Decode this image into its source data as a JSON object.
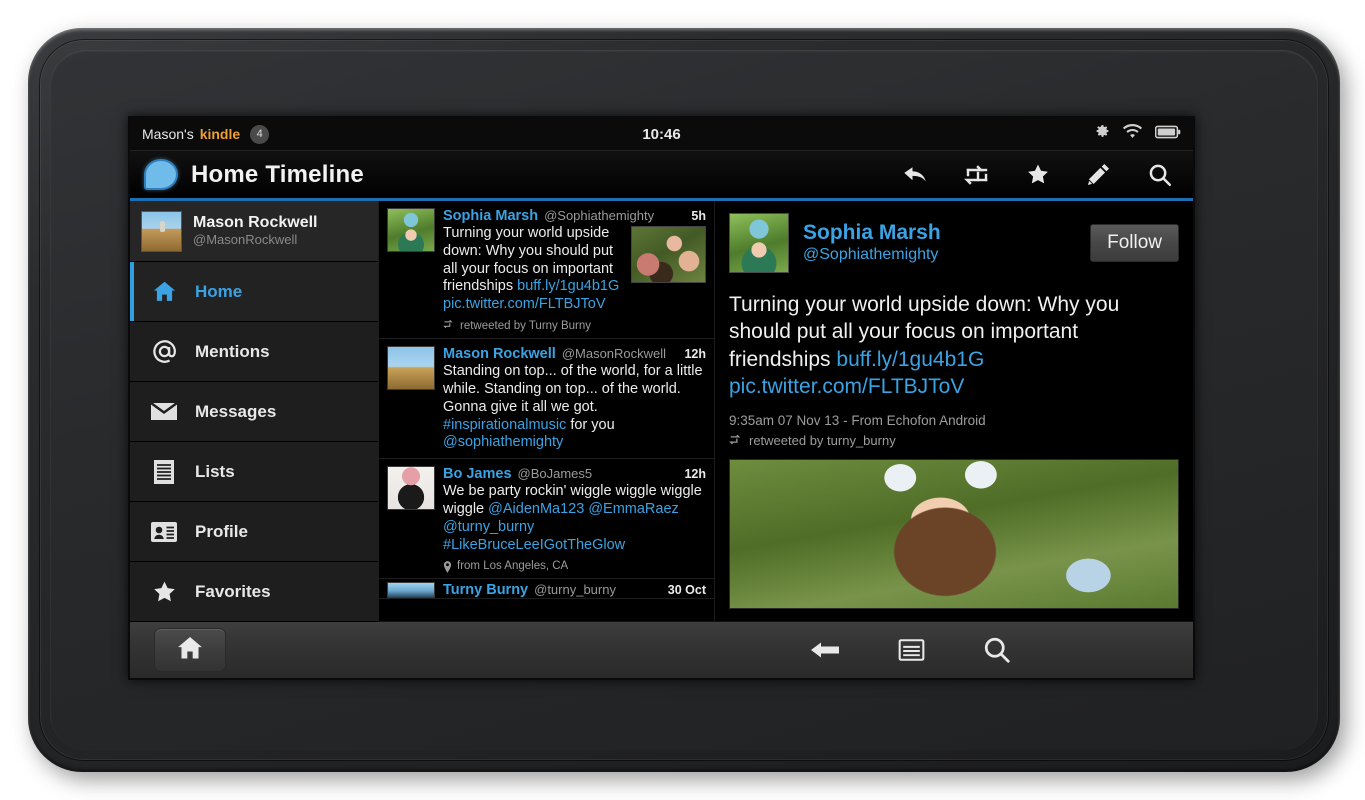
{
  "device": {
    "frame_color": "#2a2c2e"
  },
  "status_bar": {
    "owner_label": "Mason's",
    "brand_label": "kindle",
    "notification_count": "4",
    "clock": "10:46",
    "icons": [
      "gear-icon",
      "wifi-icon",
      "battery-icon"
    ]
  },
  "app_header": {
    "title": "Home Timeline",
    "accent_color": "#1b6fb5",
    "actions": [
      "reply-icon",
      "retweet-icon",
      "star-icon",
      "compose-pencil-icon",
      "search-icon"
    ]
  },
  "sidebar": {
    "account": {
      "name": "Mason Rockwell",
      "handle": "@MasonRockwell"
    },
    "items": [
      {
        "label": "Home",
        "icon": "home-icon",
        "active": true
      },
      {
        "label": "Mentions",
        "icon": "at-sign-icon",
        "active": false
      },
      {
        "label": "Messages",
        "icon": "envelope-icon",
        "active": false
      },
      {
        "label": "Lists",
        "icon": "list-icon",
        "active": false
      },
      {
        "label": "Profile",
        "icon": "contact-card-icon",
        "active": false
      },
      {
        "label": "Favorites",
        "icon": "star-icon",
        "active": false
      }
    ]
  },
  "tweet_list": [
    {
      "name": "Sophia Marsh",
      "handle": "@Sophiathemighty",
      "time": "5h",
      "text_parts": [
        {
          "t": "Turning your world upside down: Why you should put all your focus on important friendships ",
          "link": false
        },
        {
          "t": "buff.ly/1gu4b1G",
          "link": true
        },
        {
          "t": " ",
          "link": false
        },
        {
          "t": "pic.twitter.com/FLTBJToV",
          "link": true
        }
      ],
      "meta_icon": "retweet-icon",
      "meta": "retweeted by Turny Burny",
      "has_image": true
    },
    {
      "name": "Mason Rockwell",
      "handle": "@MasonRockwell",
      "time": "12h",
      "text_parts": [
        {
          "t": "Standing on top... of the world, for a little while. Standing on top... of the world. Gonna give it all we got. ",
          "link": false
        },
        {
          "t": "#inspirationalmusic",
          "link": true
        },
        {
          "t": " for you ",
          "link": false
        },
        {
          "t": "@sophiathemighty",
          "link": true
        }
      ],
      "meta_icon": "",
      "meta": "",
      "has_image": false
    },
    {
      "name": "Bo James",
      "handle": "@BoJames5",
      "time": "12h",
      "text_parts": [
        {
          "t": "We be party rockin' wiggle wiggle wiggle wiggle ",
          "link": false
        },
        {
          "t": "@AidenMa123",
          "link": true
        },
        {
          "t": " ",
          "link": false
        },
        {
          "t": "@EmmaRaez",
          "link": true
        },
        {
          "t": " ",
          "link": false
        },
        {
          "t": "@turny_burny",
          "link": true
        },
        {
          "t": " ",
          "link": false
        },
        {
          "t": "#LikeBruceLeeIGotTheGlow",
          "link": true
        }
      ],
      "meta_icon": "location-pin-icon",
      "meta": "from Los Angeles, CA",
      "has_image": false
    },
    {
      "name": "Turny Burny",
      "handle": "@turny_burny",
      "time": "30 Oct",
      "text_parts": [],
      "meta_icon": "",
      "meta": "",
      "has_image": false
    }
  ],
  "detail": {
    "name": "Sophia Marsh",
    "handle": "@Sophiathemighty",
    "follow_label": "Follow",
    "text_parts": [
      {
        "t": "Turning your world upside down: Why you should put all your focus on important friendships ",
        "link": false
      },
      {
        "t": "buff.ly/1gu4b1G",
        "link": true
      },
      {
        "t": " ",
        "link": false
      },
      {
        "t": "pic.twitter.com/FLTBJToV",
        "link": true
      }
    ],
    "timestamp": "9:35am 07 Nov 13 - From Echofon Android",
    "retweet_label": "retweeted by turny_burny",
    "photo_alt": "person-lying-on-grass-photo"
  },
  "system_bar": {
    "home_icon": "home-icon",
    "actions": [
      "back-arrow-icon",
      "menu-icon",
      "search-icon"
    ]
  }
}
